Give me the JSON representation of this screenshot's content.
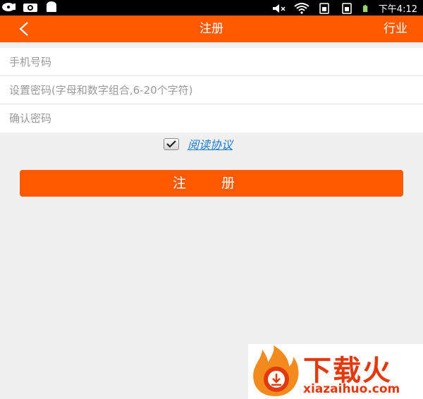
{
  "status_bar": {
    "time": "下午4:12",
    "icons": [
      "disc-icon",
      "camera-icon",
      "android-icon",
      "mute-icon",
      "wifi-icon",
      "sim-icon",
      "sim-icon",
      "battery-icon"
    ]
  },
  "header": {
    "title": "注册",
    "right_action": "行业",
    "back_icon": "chevron-left-icon"
  },
  "form": {
    "phone_placeholder": "手机号码",
    "password_placeholder": "设置密码(字母和数字组合,6-20个字符)",
    "confirm_placeholder": "确认密码",
    "agree_checked": true,
    "agree_label": "阅读协议"
  },
  "submit_label": "注 册",
  "watermark": {
    "title": "下载火",
    "url": "xiazaihuo.com"
  },
  "colors": {
    "accent": "#ff5a00",
    "link": "#1e7bd8",
    "background": "#f0f0f0"
  }
}
